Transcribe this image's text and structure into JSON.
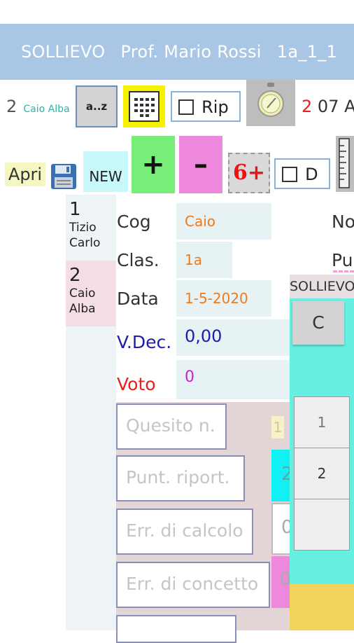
{
  "app": {
    "title_app": "SOLLIEVO",
    "title_teacher": "Prof. Mario Rossi",
    "title_class": "1a_1_1"
  },
  "toolbar1": {
    "current_number": "2",
    "current_name": "Caio Alba",
    "az_label": "a..z",
    "rip_label": "Rip",
    "date_number": "2",
    "date_rest": "07 A"
  },
  "toolbar2": {
    "apri_label": "Apri",
    "new_label": "NEW",
    "plus_label": "+",
    "minus_label": "–",
    "sixplus_label": "6+",
    "d_label": "D"
  },
  "students": [
    {
      "number": "1",
      "first": "Tizio",
      "second": "Carlo"
    },
    {
      "number": "2",
      "first": "Caio",
      "second": "Alba"
    }
  ],
  "form": {
    "cog_label": "Cog",
    "cog_value": "Caio",
    "clas_label": "Clas.",
    "clas_value": "1a",
    "data_label": "Data",
    "data_value": "1-5-2020",
    "vdec_label": "V.Dec.",
    "vdec_value": "0,00",
    "voto_label": "Voto",
    "voto_value": "0",
    "no_label": "No",
    "pu_label": "Pu"
  },
  "inputs": {
    "quesito_placeholder": "Quesito n.",
    "punt_placeholder": "Punt. riport.",
    "err_calc_placeholder": "Err. di calcolo",
    "err_conc_placeholder": "Err. di concetto"
  },
  "side_values": {
    "badge": "1",
    "cyan": "2",
    "v1": "0",
    "v2": "0"
  },
  "popup": {
    "title": "SOLLIEVO",
    "c_label": "C",
    "items": [
      "1",
      "2",
      ""
    ]
  },
  "colors": {
    "titlebar": "#a9c6e4",
    "green_button": "#77ee77",
    "pink_button": "#ee88dd",
    "cyan": "#c9f8fb",
    "popup": "#66f0e2",
    "name_accent": "#2bb6a8",
    "label_blue": "#1d1daa",
    "label_red": "#e8201e",
    "value_orange": "#f07a18",
    "value_purple": "#cc22cc"
  }
}
